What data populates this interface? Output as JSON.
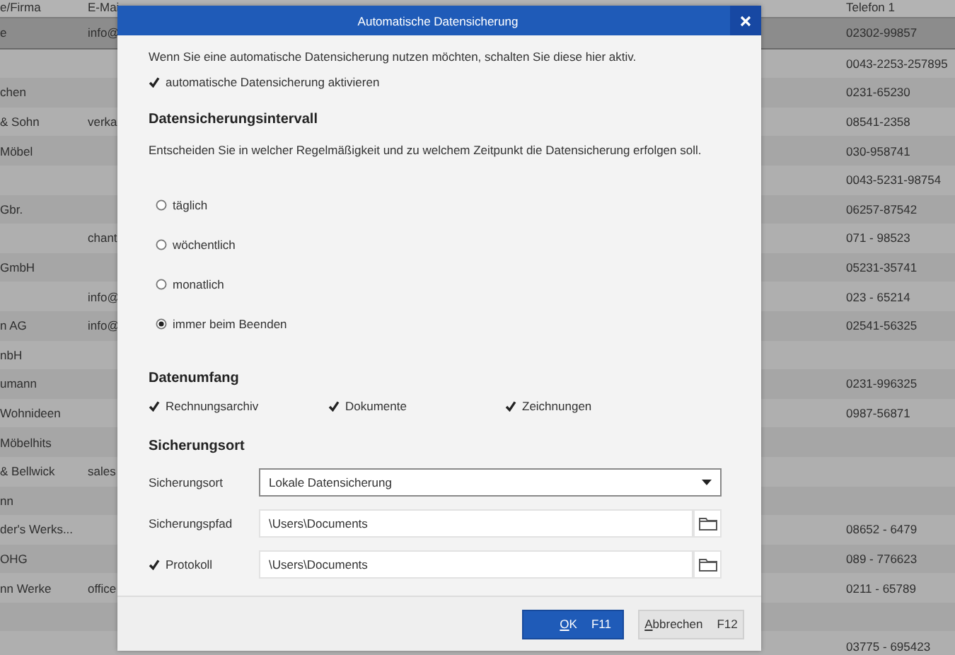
{
  "table": {
    "columns": [
      "e/Firma",
      "E-Mai",
      "Telefon 1"
    ],
    "rows": [
      {
        "firma": "e",
        "e_mail": "info@",
        "telefon_1": "02302-99857",
        "selected": true
      },
      {
        "telefon_1": "0043-2253-257895",
        "selected": false
      },
      {
        "firma": "chen",
        "telefon_1": "0231-65230",
        "selected": false
      },
      {
        "firma": "& Sohn",
        "e_mail": "verka",
        "telefon_1": "08541-2358",
        "selected": false
      },
      {
        "firma": "Möbel",
        "telefon_1": "030-958741",
        "selected": false
      },
      {
        "telefon_1": "0043-5231-98754",
        "selected": false
      },
      {
        "firma": "Gbr.",
        "telefon_1": "06257-87542",
        "selected": false
      },
      {
        "e_mail": "chant",
        "telefon_1": "071 - 98523",
        "selected": false
      },
      {
        "firma": "GmbH",
        "telefon_1": "05231-35741",
        "selected": false
      },
      {
        "e_mail": "info@",
        "telefon_1": "023 - 65214",
        "selected": false
      },
      {
        "firma": "n AG",
        "e_mail": "info@",
        "telefon_1": "02541-56325",
        "selected": false
      },
      {
        "firma": "nbH",
        "selected": false
      },
      {
        "firma": "umann",
        "telefon_1": "0231-996325",
        "selected": false
      },
      {
        "firma": "Wohnideen",
        "telefon_1": "0987-56871",
        "selected": false
      },
      {
        "firma": "Möbelhits",
        "selected": false
      },
      {
        "firma": "& Bellwick",
        "e_mail": "sales",
        "selected": false
      },
      {
        "firma": "nn",
        "selected": false
      },
      {
        "firma": "der's Werks...",
        "telefon_1": "08652 - 6479",
        "selected": false
      },
      {
        "firma": "OHG",
        "telefon_1": "089 - 776623",
        "selected": false
      },
      {
        "firma": "nn Werke",
        "e_mail": "office",
        "telefon_1": "0211 - 65789",
        "selected": false
      },
      {
        "selected": false
      },
      {
        "telefon_1": "03775 - 695423",
        "selected": false
      }
    ]
  },
  "dialog": {
    "title": "Automatische Datensicherung",
    "intro": "Wenn Sie eine automatische Datensicherung nutzen möchten, schalten Sie diese hier aktiv.",
    "enable": {
      "label": "automatische Datensicherung aktivieren",
      "checked": true
    },
    "intervall": {
      "heading": "Datensicherungsintervall",
      "description": "Entscheiden Sie in welcher Regelmäßigkeit und zu welchem Zeitpunkt die Datensicherung erfolgen soll.",
      "options": [
        {
          "label": "täglich",
          "selected": false
        },
        {
          "label": "wöchentlich",
          "selected": false
        },
        {
          "label": "monatlich",
          "selected": false
        },
        {
          "label": "immer beim Beenden",
          "selected": true
        }
      ]
    },
    "umfang": {
      "heading": "Datenumfang",
      "items": [
        {
          "label": "Rechnungsarchiv",
          "checked": true
        },
        {
          "label": "Dokumente",
          "checked": true
        },
        {
          "label": "Zeichnungen",
          "checked": true
        }
      ]
    },
    "ort": {
      "heading": "Sicherungsort",
      "fields": [
        {
          "kind": "dropdown",
          "label": "Sicherungsort",
          "value": "Lokale Datensicherung"
        },
        {
          "kind": "path",
          "label": "Sicherungspfad",
          "value": "\\Users\\Documents"
        },
        {
          "kind": "checkpath",
          "label": "Protokoll",
          "checked": true,
          "value": "\\Users\\Documents"
        }
      ]
    },
    "buttons": [
      {
        "kind": "primary",
        "label": "OK",
        "shortcut": "F11"
      },
      {
        "kind": "secondary",
        "label": "Abbrechen",
        "shortcut": "F12"
      }
    ]
  }
}
